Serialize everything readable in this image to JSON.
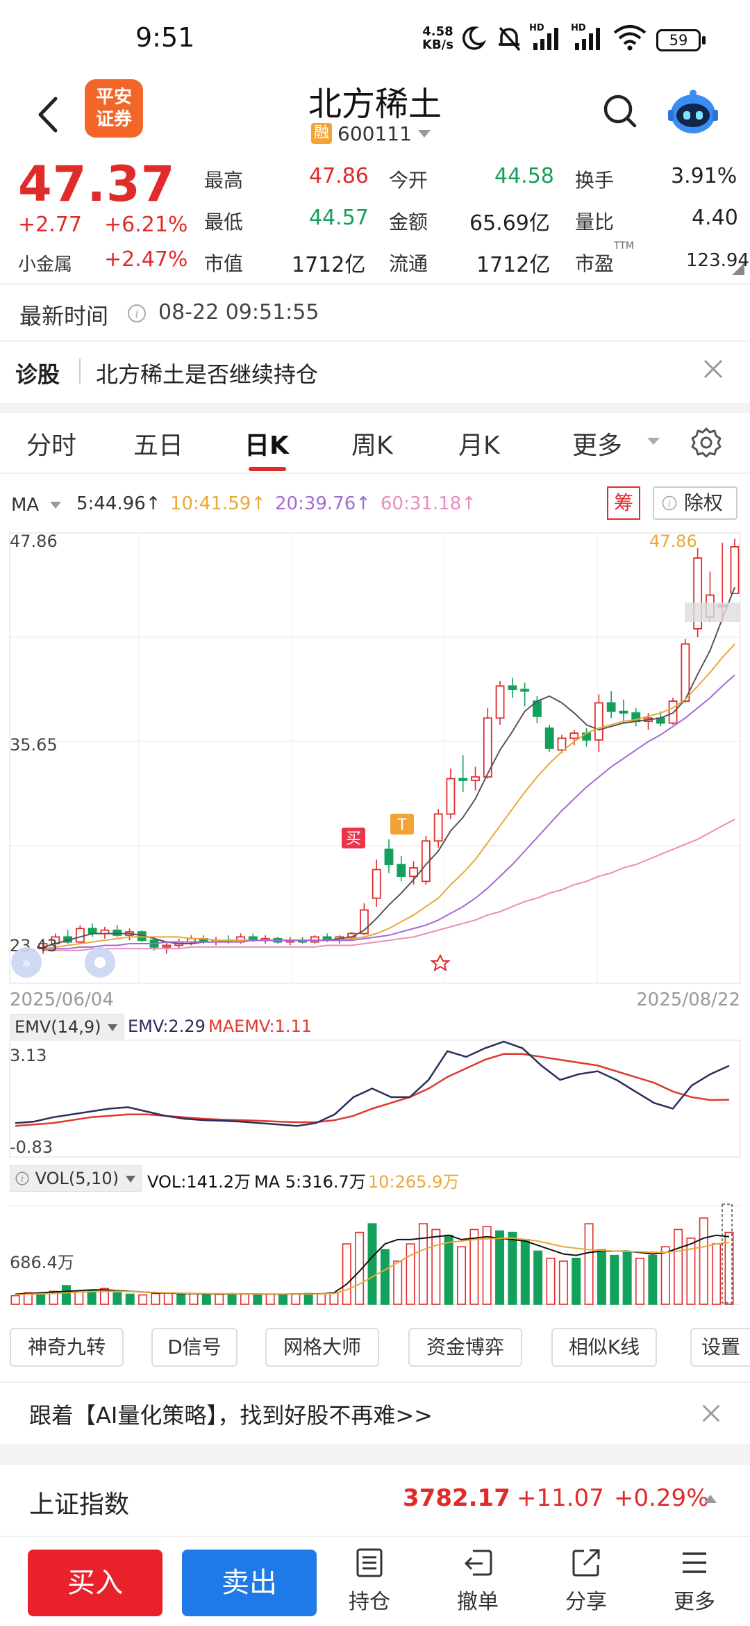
{
  "status_bar": {
    "time": "9:51",
    "net_speed_value": "4.58",
    "net_speed_unit": "KB/s",
    "battery": "59"
  },
  "header": {
    "brand_line1": "平安",
    "brand_line2": "证券",
    "stock_name": "北方稀土",
    "margin_badge": "融",
    "stock_code": "600111"
  },
  "quote": {
    "price": "47.37",
    "change": "+2.77",
    "change_pct": "+6.21%",
    "sector_name": "小金属",
    "sector_pct": "+2.47%",
    "high_label": "最高",
    "high": "47.86",
    "low_label": "最低",
    "low": "44.57",
    "mktcap_label": "市值",
    "mktcap": "1712亿",
    "open_label": "今开",
    "open": "44.58",
    "amount_label": "金额",
    "amount": "65.69亿",
    "float_label": "流通",
    "float": "1712亿",
    "turnover_label": "换手",
    "turnover": "3.91%",
    "vol_ratio_label": "量比",
    "vol_ratio": "4.40",
    "pe_label": "市盈",
    "pe_sup": "TTM",
    "pe": "123.94"
  },
  "update_time": {
    "label": "最新时间",
    "value": "08-22 09:51:55"
  },
  "diagnosis": {
    "label": "诊股",
    "text": "北方稀土是否继续持仓"
  },
  "tabs": [
    "分时",
    "五日",
    "日K",
    "周K",
    "月K",
    "更多"
  ],
  "active_tab": "日K",
  "ma_row": {
    "label": "MA",
    "ma5": "5:44.96↑",
    "ma10": "10:41.59↑",
    "ma20": "20:39.76↑",
    "ma60": "60:31.18↑",
    "chip_button": "筹",
    "adjust_button": "除权"
  },
  "colors": {
    "up": "#e02b2b",
    "down": "#13a05a",
    "ma5": "#555555",
    "ma10": "#e8a83a",
    "ma20": "#a36ad6",
    "ma60": "#e98cc0",
    "emv": "#2b2d5c",
    "maemv": "#e0382c",
    "sell_blue": "#1f7ae8"
  },
  "chart_data": {
    "type": "candlestick",
    "y_max_label": "47.86",
    "y_mid_label": "35.65",
    "y_min_label": "23.43",
    "high_marker": "47.86",
    "x_start_label": "2025/06/04",
    "x_end_label": "2025/08/22",
    "ylim": [
      23.43,
      47.86
    ],
    "buy_marker": "买",
    "t_marker": "T",
    "candles": [
      {
        "o": 23.5,
        "h": 24.0,
        "l": 23.2,
        "c": 23.8
      },
      {
        "o": 23.8,
        "h": 24.4,
        "l": 23.6,
        "c": 24.2
      },
      {
        "o": 24.2,
        "h": 24.6,
        "l": 23.8,
        "c": 23.9
      },
      {
        "o": 23.9,
        "h": 24.9,
        "l": 23.8,
        "c": 24.7
      },
      {
        "o": 24.7,
        "h": 25.0,
        "l": 24.2,
        "c": 24.4
      },
      {
        "o": 24.4,
        "h": 24.8,
        "l": 24.1,
        "c": 24.6
      },
      {
        "o": 24.6,
        "h": 24.9,
        "l": 24.2,
        "c": 24.3
      },
      {
        "o": 24.3,
        "h": 24.7,
        "l": 24.0,
        "c": 24.5
      },
      {
        "o": 24.5,
        "h": 24.6,
        "l": 23.9,
        "c": 24.0
      },
      {
        "o": 24.0,
        "h": 24.2,
        "l": 23.4,
        "c": 23.6
      },
      {
        "o": 23.6,
        "h": 23.9,
        "l": 23.2,
        "c": 23.7
      },
      {
        "o": 23.7,
        "h": 24.1,
        "l": 23.5,
        "c": 23.9
      },
      {
        "o": 23.9,
        "h": 24.3,
        "l": 23.7,
        "c": 24.1
      },
      {
        "o": 24.1,
        "h": 24.3,
        "l": 23.8,
        "c": 23.9
      },
      {
        "o": 23.9,
        "h": 24.2,
        "l": 23.7,
        "c": 24.0
      },
      {
        "o": 24.0,
        "h": 24.3,
        "l": 23.8,
        "c": 23.9
      },
      {
        "o": 23.9,
        "h": 24.4,
        "l": 23.8,
        "c": 24.2
      },
      {
        "o": 24.2,
        "h": 24.4,
        "l": 23.9,
        "c": 24.0
      },
      {
        "o": 24.0,
        "h": 24.3,
        "l": 23.8,
        "c": 24.1
      },
      {
        "o": 24.1,
        "h": 24.2,
        "l": 23.8,
        "c": 23.9
      },
      {
        "o": 23.9,
        "h": 24.2,
        "l": 23.7,
        "c": 24.0
      },
      {
        "o": 24.0,
        "h": 24.2,
        "l": 23.8,
        "c": 23.9
      },
      {
        "o": 23.9,
        "h": 24.3,
        "l": 23.8,
        "c": 24.2
      },
      {
        "o": 24.2,
        "h": 24.4,
        "l": 23.9,
        "c": 24.0
      },
      {
        "o": 24.0,
        "h": 24.3,
        "l": 23.8,
        "c": 24.2
      },
      {
        "o": 24.2,
        "h": 24.5,
        "l": 24.0,
        "c": 24.4
      },
      {
        "o": 24.4,
        "h": 26.2,
        "l": 24.3,
        "c": 25.8
      },
      {
        "o": 26.5,
        "h": 28.8,
        "l": 26.0,
        "c": 28.2
      },
      {
        "o": 29.4,
        "h": 30.0,
        "l": 28.0,
        "c": 28.5
      },
      {
        "o": 28.5,
        "h": 29.0,
        "l": 27.5,
        "c": 27.8
      },
      {
        "o": 27.8,
        "h": 28.7,
        "l": 27.3,
        "c": 28.3
      },
      {
        "o": 27.5,
        "h": 30.2,
        "l": 27.3,
        "c": 29.9
      },
      {
        "o": 29.9,
        "h": 31.8,
        "l": 29.5,
        "c": 31.5
      },
      {
        "o": 31.5,
        "h": 34.2,
        "l": 31.2,
        "c": 33.6
      },
      {
        "o": 33.6,
        "h": 35.0,
        "l": 32.8,
        "c": 33.5
      },
      {
        "o": 33.5,
        "h": 34.3,
        "l": 32.9,
        "c": 33.7
      },
      {
        "o": 33.7,
        "h": 37.8,
        "l": 33.6,
        "c": 37.2
      },
      {
        "o": 37.2,
        "h": 39.4,
        "l": 36.8,
        "c": 39.1
      },
      {
        "o": 39.1,
        "h": 39.6,
        "l": 38.4,
        "c": 38.9
      },
      {
        "o": 38.9,
        "h": 39.3,
        "l": 37.9,
        "c": 38.8
      },
      {
        "o": 38.2,
        "h": 38.5,
        "l": 36.9,
        "c": 37.3
      },
      {
        "o": 36.6,
        "h": 36.8,
        "l": 35.2,
        "c": 35.4
      },
      {
        "o": 35.3,
        "h": 36.2,
        "l": 35.1,
        "c": 36.0
      },
      {
        "o": 36.0,
        "h": 36.5,
        "l": 35.6,
        "c": 36.3
      },
      {
        "o": 36.3,
        "h": 36.6,
        "l": 35.5,
        "c": 35.9
      },
      {
        "o": 35.9,
        "h": 38.6,
        "l": 35.2,
        "c": 38.1
      },
      {
        "o": 38.1,
        "h": 38.8,
        "l": 37.2,
        "c": 37.6
      },
      {
        "o": 37.6,
        "h": 38.3,
        "l": 36.9,
        "c": 37.5
      },
      {
        "o": 37.5,
        "h": 37.8,
        "l": 36.7,
        "c": 37.0
      },
      {
        "o": 37.0,
        "h": 37.5,
        "l": 36.5,
        "c": 37.2
      },
      {
        "o": 37.2,
        "h": 37.6,
        "l": 36.7,
        "c": 36.9
      },
      {
        "o": 36.9,
        "h": 38.4,
        "l": 36.8,
        "c": 38.2
      },
      {
        "o": 38.2,
        "h": 41.9,
        "l": 38.1,
        "c": 41.6
      },
      {
        "o": 42.5,
        "h": 47.3,
        "l": 42.0,
        "c": 46.7
      },
      {
        "o": 43.2,
        "h": 45.9,
        "l": 42.9,
        "c": 44.5
      },
      {
        "o": 43.8,
        "h": 47.6,
        "l": 43.0,
        "c": 43.9
      },
      {
        "o": 44.6,
        "h": 47.86,
        "l": 44.57,
        "c": 47.37
      }
    ],
    "ma5": [
      23.6,
      23.8,
      24.0,
      24.2,
      24.4,
      24.4,
      24.4,
      24.4,
      24.3,
      24.1,
      23.9,
      23.8,
      23.8,
      23.9,
      23.9,
      24.0,
      24.0,
      24.0,
      24.0,
      24.0,
      24.0,
      24.0,
      24.0,
      24.0,
      24.1,
      24.2,
      24.6,
      25.3,
      26.1,
      26.8,
      27.6,
      28.5,
      29.3,
      30.5,
      31.3,
      32.4,
      33.9,
      35.3,
      36.4,
      37.6,
      38.2,
      38.5,
      38.1,
      37.5,
      36.8,
      36.5,
      36.7,
      36.9,
      37.0,
      37.1,
      37.2,
      37.5,
      38.3,
      39.8,
      41.2,
      43.1,
      44.96
    ],
    "ma10": [
      23.5,
      23.6,
      23.7,
      23.8,
      23.9,
      24.0,
      24.1,
      24.2,
      24.2,
      24.2,
      24.2,
      24.2,
      24.1,
      24.1,
      24.0,
      24.0,
      24.0,
      24.0,
      24.0,
      24.0,
      24.0,
      24.0,
      24.0,
      24.0,
      24.0,
      24.1,
      24.2,
      24.4,
      24.7,
      25.1,
      25.5,
      26.0,
      26.5,
      27.3,
      28.0,
      28.8,
      29.8,
      30.8,
      31.8,
      32.8,
      33.7,
      34.5,
      35.2,
      35.8,
      36.3,
      36.6,
      36.8,
      37.0,
      37.1,
      37.3,
      37.5,
      37.8,
      38.3,
      39.1,
      39.9,
      40.8,
      41.59
    ],
    "ma20": [
      23.4,
      23.5,
      23.5,
      23.6,
      23.6,
      23.7,
      23.7,
      23.8,
      23.8,
      23.8,
      23.9,
      23.9,
      23.9,
      23.9,
      23.9,
      23.9,
      23.9,
      24.0,
      24.0,
      24.0,
      24.0,
      24.0,
      24.0,
      24.0,
      24.0,
      24.0,
      24.1,
      24.2,
      24.3,
      24.5,
      24.7,
      24.9,
      25.2,
      25.6,
      26.0,
      26.5,
      27.1,
      27.8,
      28.5,
      29.3,
      30.1,
      30.9,
      31.7,
      32.4,
      33.1,
      33.7,
      34.3,
      34.8,
      35.3,
      35.8,
      36.2,
      36.7,
      37.2,
      37.8,
      38.4,
      39.1,
      39.76
    ],
    "ma60": [
      23.4,
      23.4,
      23.4,
      23.4,
      23.5,
      23.5,
      23.5,
      23.5,
      23.5,
      23.5,
      23.5,
      23.5,
      23.6,
      23.6,
      23.6,
      23.6,
      23.6,
      23.6,
      23.6,
      23.6,
      23.6,
      23.6,
      23.6,
      23.7,
      23.7,
      23.7,
      23.8,
      23.9,
      24.0,
      24.1,
      24.2,
      24.4,
      24.6,
      24.8,
      25.0,
      25.2,
      25.5,
      25.7,
      26.0,
      26.3,
      26.5,
      26.8,
      27.0,
      27.3,
      27.5,
      27.8,
      28.0,
      28.3,
      28.5,
      28.8,
      29.1,
      29.4,
      29.7,
      30.0,
      30.4,
      30.8,
      31.18
    ]
  },
  "emv": {
    "label": "EMV(14,9)",
    "emv_value": "EMV:2.29",
    "maemv_value": "MAEMV:1.11",
    "y_max_label": "3.13",
    "y_min_label": "-0.83",
    "emv_series": [
      0.3,
      0.35,
      0.5,
      0.6,
      0.7,
      0.8,
      0.85,
      0.7,
      0.55,
      0.45,
      0.4,
      0.38,
      0.35,
      0.3,
      0.25,
      0.2,
      0.3,
      0.6,
      1.2,
      1.5,
      1.2,
      1.2,
      1.8,
      2.8,
      2.6,
      2.9,
      3.13,
      2.9,
      2.3,
      1.8,
      2.0,
      2.1,
      1.8,
      1.4,
      1.0,
      0.8,
      1.6,
      2.0,
      2.29
    ],
    "maemv_series": [
      0.2,
      0.25,
      0.3,
      0.4,
      0.5,
      0.55,
      0.6,
      0.6,
      0.55,
      0.5,
      0.45,
      0.42,
      0.4,
      0.38,
      0.35,
      0.33,
      0.33,
      0.4,
      0.55,
      0.8,
      1.0,
      1.2,
      1.5,
      1.9,
      2.2,
      2.5,
      2.7,
      2.7,
      2.6,
      2.5,
      2.4,
      2.3,
      2.1,
      1.9,
      1.7,
      1.4,
      1.2,
      1.1,
      1.11
    ]
  },
  "volume": {
    "label": "VOL(5,10)",
    "vol_value": "VOL:141.2万",
    "ma5_value": "MA 5:316.7万",
    "ma10_value": "10:265.9万",
    "y_label": "686.4万",
    "bars": [
      60,
      80,
      70,
      90,
      130,
      85,
      95,
      110,
      80,
      70,
      65,
      75,
      80,
      70,
      75,
      72,
      68,
      74,
      70,
      66,
      70,
      68,
      73,
      75,
      72,
      80,
      420,
      500,
      560,
      380,
      300,
      420,
      560,
      520,
      480,
      400,
      520,
      540,
      510,
      500,
      450,
      370,
      320,
      300,
      320,
      560,
      380,
      340,
      360,
      320,
      340,
      400,
      520,
      460,
      600,
      420,
      500
    ],
    "ma5": [
      70,
      75,
      80,
      85,
      90,
      95,
      100,
      100,
      95,
      90,
      85,
      80,
      78,
      75,
      74,
      73,
      72,
      72,
      72,
      71,
      70,
      70,
      71,
      72,
      73,
      80,
      140,
      230,
      330,
      420,
      450,
      450,
      460,
      470,
      480,
      450,
      460,
      470,
      460,
      450,
      440,
      410,
      380,
      350,
      340,
      360,
      370,
      370,
      370,
      360,
      350,
      360,
      390,
      420,
      460,
      480,
      470
    ],
    "ma10": [
      65,
      70,
      72,
      75,
      80,
      85,
      88,
      90,
      90,
      88,
      85,
      83,
      80,
      78,
      76,
      75,
      74,
      73,
      72,
      72,
      71,
      71,
      71,
      71,
      72,
      75,
      100,
      140,
      190,
      240,
      290,
      340,
      380,
      410,
      430,
      440,
      450,
      455,
      460,
      460,
      450,
      440,
      420,
      400,
      390,
      380,
      375,
      370,
      368,
      365,
      362,
      362,
      370,
      385,
      400,
      420,
      430
    ]
  },
  "indicator_buttons": [
    "神奇九转",
    "D信号",
    "网格大师",
    "资金博弈",
    "相似K线",
    "设置"
  ],
  "promo": {
    "text": "跟着【AI量化策略】，找到好股不再难>>"
  },
  "index_row": {
    "name": "上证指数",
    "value": "3782.17",
    "change": "+11.07",
    "change_pct": "+0.29%"
  },
  "bottom_bar": {
    "buy": "买入",
    "sell": "卖出",
    "nav": [
      "持仓",
      "撤单",
      "分享",
      "更多"
    ]
  }
}
